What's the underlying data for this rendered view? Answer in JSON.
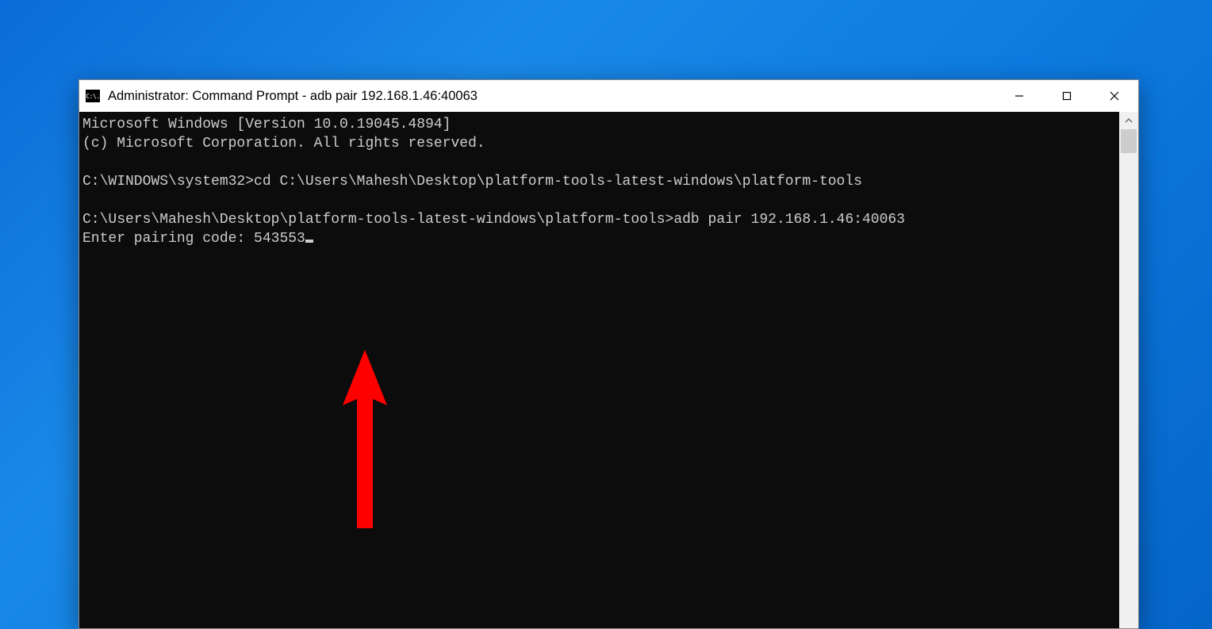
{
  "window": {
    "title": "Administrator: Command Prompt - adb  pair 192.168.1.46:40063",
    "icon_label": "C:\\."
  },
  "console": {
    "line1": "Microsoft Windows [Version 10.0.19045.4894]",
    "line2": "(c) Microsoft Corporation. All rights reserved.",
    "blank1": "",
    "line3": "C:\\WINDOWS\\system32>cd C:\\Users\\Mahesh\\Desktop\\platform-tools-latest-windows\\platform-tools",
    "blank2": "",
    "line4": "C:\\Users\\Mahesh\\Desktop\\platform-tools-latest-windows\\platform-tools>adb pair 192.168.1.46:40063",
    "line5_prefix": "Enter pairing code: ",
    "line5_value": "543553"
  },
  "annotation": {
    "arrow_color": "#ff0000"
  }
}
